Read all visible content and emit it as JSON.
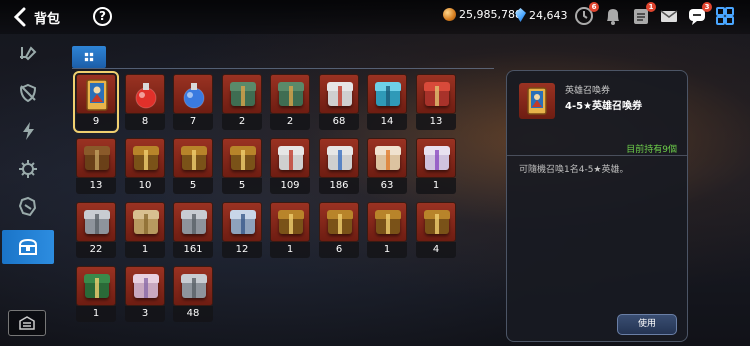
{
  "header": {
    "title": "背包",
    "help_label": "?",
    "gold": "25,985,788",
    "gems": "24,643",
    "badges": {
      "history": "6",
      "quests": "1",
      "mail": "3"
    }
  },
  "sidebar": {
    "items": [
      {
        "icon": "equipment-icon"
      },
      {
        "icon": "shield-icon"
      },
      {
        "icon": "lightning-icon"
      },
      {
        "icon": "gear-icon"
      },
      {
        "icon": "rune-icon"
      },
      {
        "icon": "chest-icon",
        "active": true
      }
    ],
    "bottom_icon": "storage-icon"
  },
  "tabs": {
    "active": "grid-icon"
  },
  "inventory": {
    "items": [
      {
        "count": "9",
        "kind": "card",
        "selected": true
      },
      {
        "count": "8",
        "kind": "potion-red"
      },
      {
        "count": "7",
        "kind": "potion-blue"
      },
      {
        "count": "2",
        "kind": "box-green"
      },
      {
        "count": "2",
        "kind": "box-green"
      },
      {
        "count": "68",
        "kind": "box-white-red"
      },
      {
        "count": "14",
        "kind": "box-cyan"
      },
      {
        "count": "13",
        "kind": "box-red"
      },
      {
        "count": "13",
        "kind": "chest-brown"
      },
      {
        "count": "10",
        "kind": "chest-gold"
      },
      {
        "count": "5",
        "kind": "chest-gold"
      },
      {
        "count": "5",
        "kind": "chest-gold"
      },
      {
        "count": "109",
        "kind": "box-white-red"
      },
      {
        "count": "186",
        "kind": "box-white-blue"
      },
      {
        "count": "63",
        "kind": "box-white-orange"
      },
      {
        "count": "1",
        "kind": "box-white-purple"
      },
      {
        "count": "22",
        "kind": "box-silver"
      },
      {
        "count": "1",
        "kind": "bag-gold"
      },
      {
        "count": "161",
        "kind": "box-silver"
      },
      {
        "count": "12",
        "kind": "box-silver-blue"
      },
      {
        "count": "1",
        "kind": "chest-gold"
      },
      {
        "count": "6",
        "kind": "chest-gold"
      },
      {
        "count": "1",
        "kind": "chest-gold"
      },
      {
        "count": "4",
        "kind": "chest-gold"
      },
      {
        "count": "1",
        "kind": "chest-green"
      },
      {
        "count": "3",
        "kind": "bag-pink"
      },
      {
        "count": "48",
        "kind": "box-silver"
      }
    ]
  },
  "detail": {
    "type": "英雄召喚券",
    "name": "4-5★英雄召喚券",
    "owned": "目前持有9個",
    "description": "可隨機召喚1名4-5★英雄。",
    "use_label": "使用"
  },
  "colors": {
    "accent": "#2d8de0",
    "owned_green": "#6ed04b",
    "cell_red": "#8b2a1c"
  }
}
